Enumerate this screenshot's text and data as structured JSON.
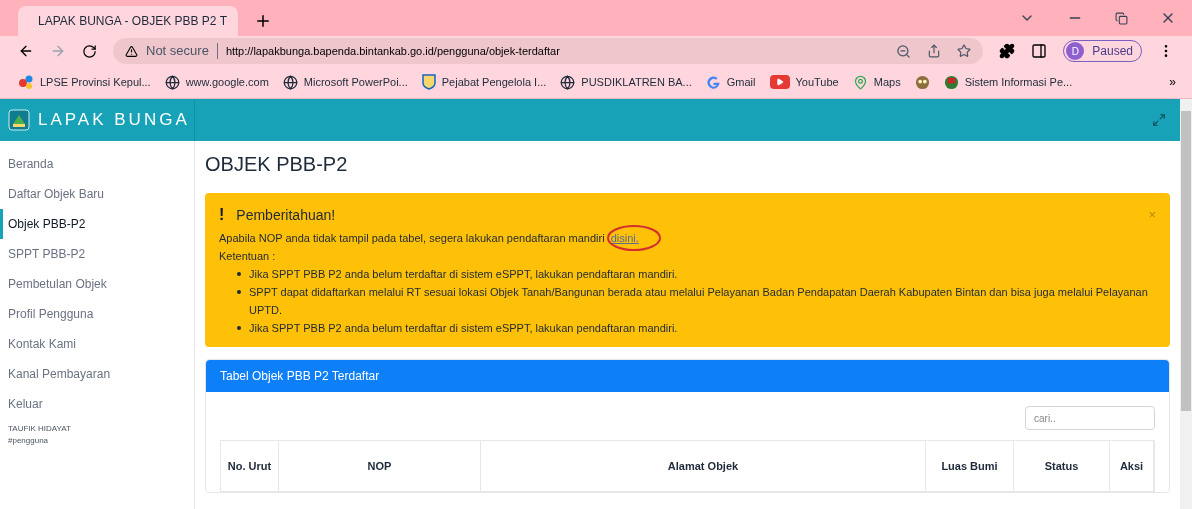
{
  "browser": {
    "tab": {
      "title": "LAPAK BUNGA - OBJEK PBB P2 T",
      "selected": true
    },
    "address": {
      "warning": "Not secure",
      "url": "http://lapakbunga.bapenda.bintankab.go.id/pengguna/objek-terdaftar"
    },
    "profile": {
      "initial": "D",
      "status": "Paused"
    },
    "bookmarks": [
      {
        "label": "LPSE Provinsi Kepul...",
        "kind": "dots"
      },
      {
        "label": "www.google.com",
        "kind": "globe"
      },
      {
        "label": "Microsoft PowerPoi...",
        "kind": "globe"
      },
      {
        "label": "Pejabat Pengelola I...",
        "kind": "shield"
      },
      {
        "label": "PUSDIKLATREN BA...",
        "kind": "globe"
      },
      {
        "label": "Gmail",
        "kind": "g"
      },
      {
        "label": "YouTube",
        "kind": "play"
      },
      {
        "label": "Maps",
        "kind": "pin"
      },
      {
        "kind": "owl"
      },
      {
        "label": "Sistem Informasi Pe...",
        "kind": "badge"
      }
    ],
    "more": "»"
  },
  "app": {
    "brand": "LAPAK BUNGA",
    "sidebar": {
      "items": [
        {
          "label": "Beranda",
          "selected": false
        },
        {
          "label": "Daftar Objek Baru",
          "selected": false
        },
        {
          "label": "Objek PBB-P2",
          "selected": true
        },
        {
          "label": "SPPT PBB-P2",
          "selected": false
        },
        {
          "label": "Pembetulan Objek",
          "selected": false
        },
        {
          "label": "Profil Pengguna",
          "selected": false
        },
        {
          "label": "Kontak Kami",
          "selected": false
        },
        {
          "label": "Kanal Pembayaran",
          "selected": false
        },
        {
          "label": "Keluar",
          "selected": false
        }
      ],
      "user": "TAUFIK HIDAYAT",
      "role": "#pengguna"
    },
    "page_title": "OBJEK PBB-P2",
    "alert": {
      "icon": "!",
      "title": "Pemberitahuan!",
      "close": "×",
      "message": "Apabila NOP anda tidak tampil pada tabel, segera lakukan pendaftaran mandiri",
      "link": "disini.",
      "link_circled": true,
      "subtitle": "Ketentuan :",
      "items": [
        "Jika SPPT PBB P2 anda belum terdaftar di sistem eSPPT, lakukan pendaftaran mandiri.",
        "SPPT dapat didaftarkan melalui RT sesuai lokasi Objek Tanah/Bangunan berada atau melalui Pelayanan Badan Pendapatan Daerah Kabupaten Bintan dan bisa juga melalui Pelayanan UPTD.",
        "Jika SPPT PBB P2 anda belum terdaftar di sistem eSPPT, lakukan pendaftaran mandiri."
      ]
    },
    "table": {
      "title": "Tabel Objek PBB P2 Terdaftar",
      "search": {
        "placeholder": "cari.."
      },
      "columns": [
        "No. Urut",
        "NOP",
        "Alamat Objek",
        "Luas Bumi",
        "Status",
        "Aksi"
      ]
    }
  }
}
